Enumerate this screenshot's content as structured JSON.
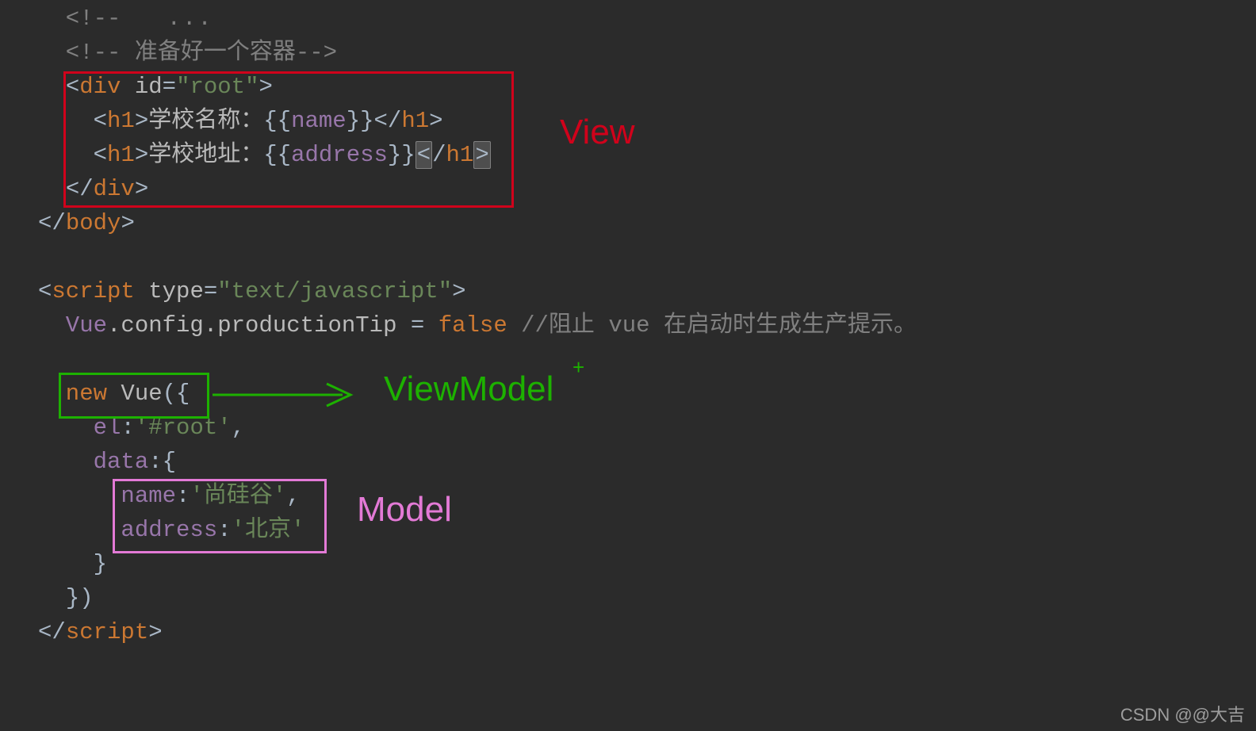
{
  "code": {
    "l1_a": "  <!--",
    "l1_b": "   ...",
    "l2": "  <!-- 准备好一个容器-->",
    "l3": "  <div id=\"root\">",
    "l3_tag": "div",
    "l3_attr": "id",
    "l3_val": "\"root\"",
    "l4_pre": "    <h1>",
    "l4_txt": "学校名称：{{name}}",
    "l4_post": "</h1>",
    "l5_pre": "    <h1>",
    "l5_txt": "学校地址：{{address}}",
    "l5_post": "</h1>",
    "l6": "  </div>",
    "l7": "</body>",
    "l8": "",
    "l9_tag": "script",
    "l9_attr": "type",
    "l9_val": "\"text/javascript\"",
    "l10_a": "  Vue",
    "l10_b": ".config.productionTip",
    "l10_c": " = ",
    "l10_d": "false",
    "l10_e": " //阻止 vue 在启动时生成生产提示。",
    "l11": "",
    "l12_a": "  new ",
    "l12_b": "Vue",
    "l12_c": "({",
    "l13": "    el:'#root',",
    "l13_key": "el",
    "l13_val": "'#root'",
    "l14": "    data:{",
    "l14_key": "data",
    "l15": "      name:'尚硅谷',",
    "l15_key": "name",
    "l15_val": "'尚硅谷'",
    "l16": "      address:'北京'",
    "l16_key": "address",
    "l16_val": "'北京'",
    "l17": "    }",
    "l18": "  })",
    "l19_tag": "script"
  },
  "labels": {
    "view": "View",
    "viewmodel": "ViewModel",
    "model": "Model",
    "plus": "+"
  },
  "watermark": "CSDN @@大吉"
}
